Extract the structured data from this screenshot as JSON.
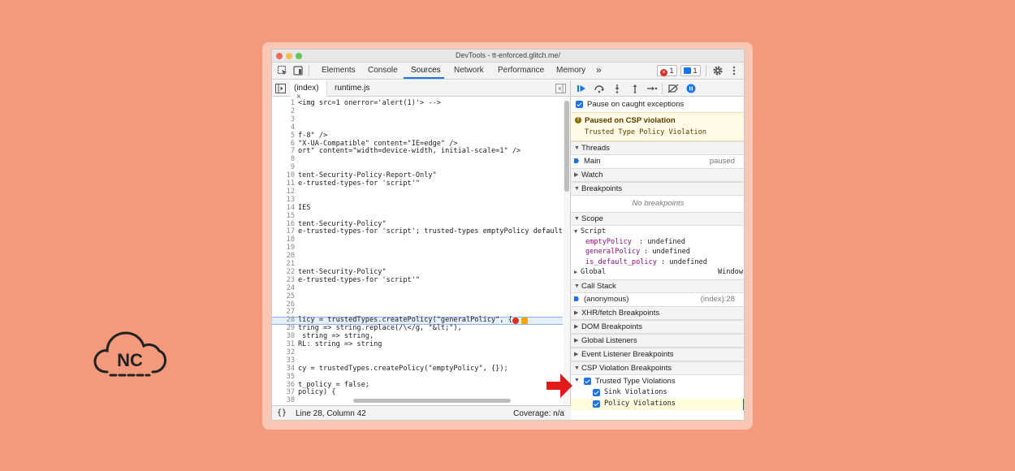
{
  "logo": {
    "text": "NC"
  },
  "window": {
    "title": "DevTools - tt-enforced.glitch.me/"
  },
  "toolbar": {
    "tabs": [
      "Elements",
      "Console",
      "Sources",
      "Network",
      "Performance",
      "Memory"
    ],
    "more": "»",
    "errors": "1",
    "messages": "1"
  },
  "files": {
    "tab1": "(index)",
    "tab2": "runtime.js",
    "close": "×"
  },
  "code": {
    "lines": [
      {
        "n": "1",
        "t": "<img src=1 onerror='alert(1)'> -->"
      },
      {
        "n": "2",
        "t": ""
      },
      {
        "n": "3",
        "t": ""
      },
      {
        "n": "4",
        "t": ""
      },
      {
        "n": "5",
        "t": "f-8\" />"
      },
      {
        "n": "6",
        "t": "\"X-UA-Compatible\" content=\"IE=edge\" />"
      },
      {
        "n": "7",
        "t": "ort\" content=\"width=device-width, initial-scale=1\" />"
      },
      {
        "n": "8",
        "t": ""
      },
      {
        "n": "9",
        "t": ""
      },
      {
        "n": "10",
        "t": "tent-Security-Policy-Report-Only\""
      },
      {
        "n": "11",
        "t": "e-trusted-types-for 'script'\""
      },
      {
        "n": "12",
        "t": ""
      },
      {
        "n": "13",
        "t": ""
      },
      {
        "n": "14",
        "t": "IES"
      },
      {
        "n": "15",
        "t": ""
      },
      {
        "n": "16",
        "t": "tent-Security-Policy\""
      },
      {
        "n": "17",
        "t": "e-trusted-types-for 'script'; trusted-types emptyPolicy default"
      },
      {
        "n": "18",
        "t": ""
      },
      {
        "n": "19",
        "t": ""
      },
      {
        "n": "20",
        "t": ""
      },
      {
        "n": "21",
        "t": ""
      },
      {
        "n": "22",
        "t": "tent-Security-Policy\""
      },
      {
        "n": "23",
        "t": "e-trusted-types-for 'script'\""
      },
      {
        "n": "24",
        "t": ""
      },
      {
        "n": "25",
        "t": ""
      },
      {
        "n": "26",
        "t": ""
      },
      {
        "n": "27",
        "t": ""
      },
      {
        "n": "28",
        "t": "licy = trustedTypes.createPolicy(\"generalPolicy\", {"
      },
      {
        "n": "29",
        "t": "tring => string.replace(/\\</g, \"&lt;\"),"
      },
      {
        "n": "30",
        "t": " string => string,"
      },
      {
        "n": "31",
        "t": "RL: string => string"
      },
      {
        "n": "32",
        "t": ""
      },
      {
        "n": "33",
        "t": ""
      },
      {
        "n": "34",
        "t": "cy = trustedTypes.createPolicy(\"emptyPolicy\", {});"
      },
      {
        "n": "35",
        "t": ""
      },
      {
        "n": "36",
        "t": "t_policy = false;"
      },
      {
        "n": "37",
        "t": "policy) {"
      },
      {
        "n": "38",
        "t": ""
      }
    ]
  },
  "status": {
    "braces": "{}",
    "position": "Line 28, Column 42",
    "coverage": "Coverage: n/a"
  },
  "debugger": {
    "pause_caught": "Pause on caught exceptions",
    "paused_title": "Paused on CSP violation",
    "paused_detail": "Trusted Type Policy Violation",
    "threads": "Threads",
    "main": "Main",
    "paused": "paused",
    "watch": "Watch",
    "breakpoints": "Breakpoints",
    "no_breakpoints": "No breakpoints",
    "scope": "Scope",
    "script": "Script",
    "scope_vars": [
      {
        "name": "emptyPolicy",
        "value": "undefined"
      },
      {
        "name": "generalPolicy",
        "value": "undefined"
      },
      {
        "name": "is_default_policy",
        "value": "undefined"
      }
    ],
    "global": "Global",
    "window": "Window",
    "call_stack": "Call Stack",
    "anonymous": "(anonymous)",
    "location": "(index):28",
    "xhr": "XHR/fetch Breakpoints",
    "dom": "DOM Breakpoints",
    "global_listeners": "Global Listeners",
    "event_listener": "Event Listener Breakpoints",
    "csp": "CSP Violation Breakpoints",
    "trusted_type": "Trusted Type Violations",
    "sink": "Sink Violations",
    "policy": "Policy Violations"
  }
}
